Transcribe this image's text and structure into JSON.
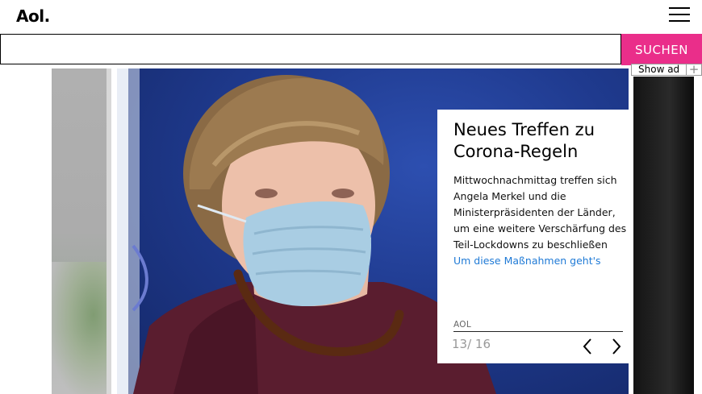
{
  "header": {
    "logo": "Aol.",
    "menu_icon": "hamburger-menu-icon"
  },
  "search": {
    "value": "",
    "placeholder": "",
    "button_label": "SUCHEN",
    "button_color": "#ea2e8a"
  },
  "ad": {
    "show_ad_label": "Show ad",
    "plus_label": "+"
  },
  "slideshow": {
    "caption": {
      "title": "Neues Treffen zu Corona-Regeln",
      "body": "Mittwochnachmittag treffen sich Angela Merkel und die Ministerpräsidenten der Länder, um eine weitere Verschärfung des Teil-Lockdowns zu beschließen",
      "link_text": "Um diese Maßnahmen geht's",
      "source": "AOL",
      "counter": "13/ 16",
      "link_color": "#1f7ad6"
    },
    "prev_icon": "chevron-left-icon",
    "next_icon": "chevron-right-icon"
  }
}
